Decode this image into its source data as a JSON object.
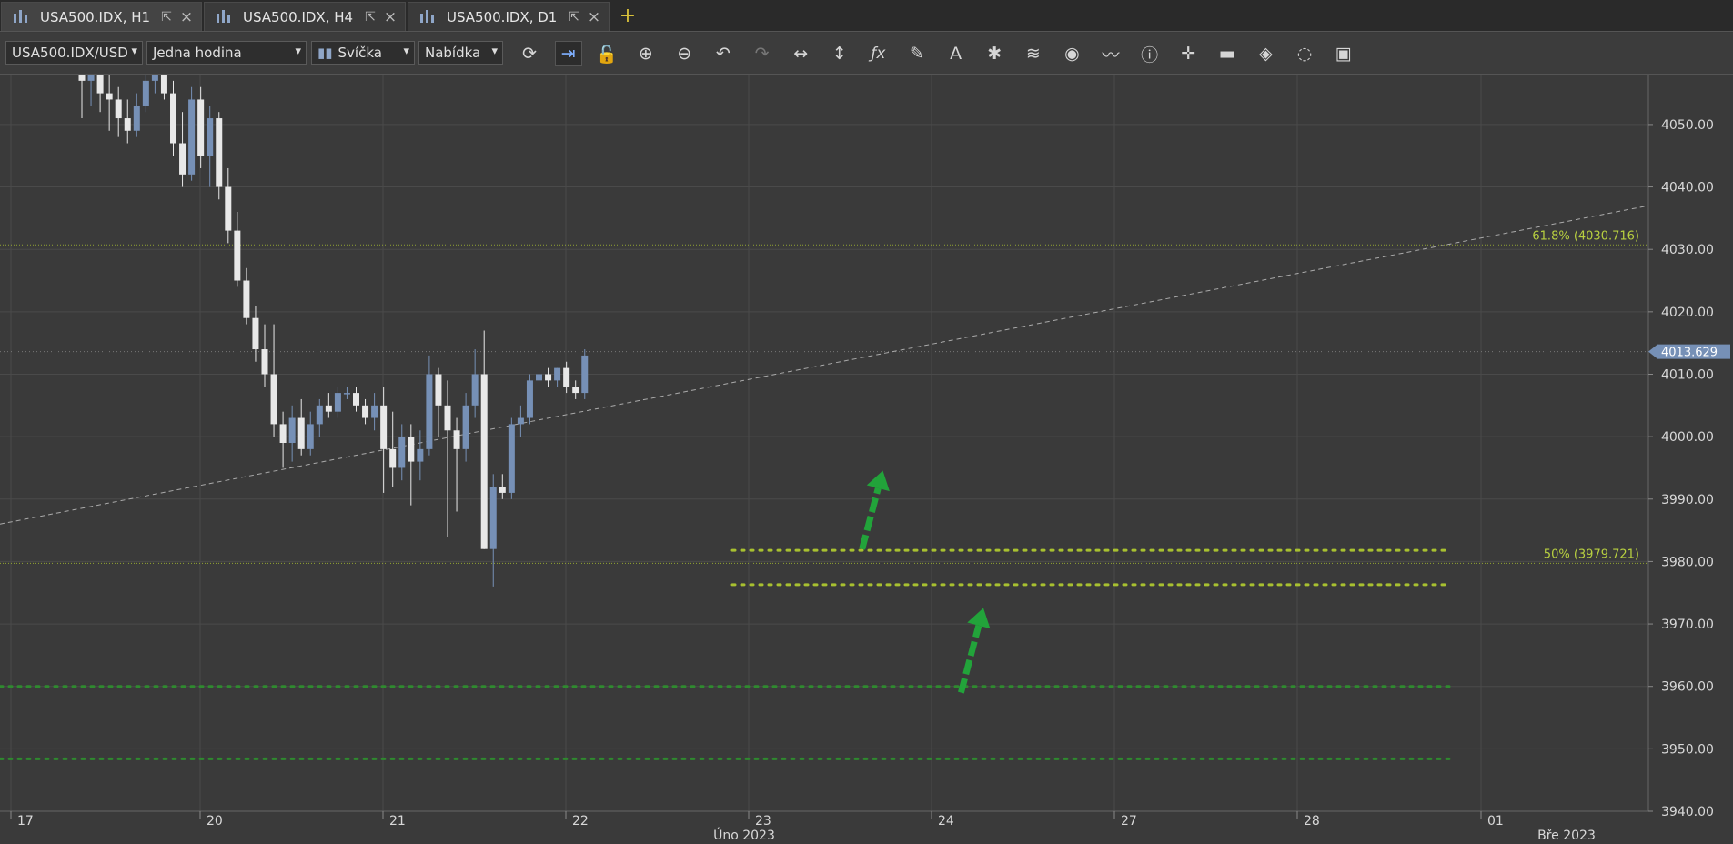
{
  "tabs": [
    {
      "label": "USA500.IDX, H1",
      "active": true
    },
    {
      "label": "USA500.IDX, H4",
      "active": false
    },
    {
      "label": "USA500.IDX, D1",
      "active": false
    }
  ],
  "toolbar": {
    "instrument": "USA500.IDX/USD",
    "period": "Jedna hodina",
    "chart_type": "Svíčka",
    "offer_side": "Nabídka",
    "buttons": [
      "refresh-icon",
      "auto-shift-icon",
      "unlock-icon",
      "zoom-in-icon",
      "zoom-out-icon",
      "undo-icon",
      "redo-icon",
      "horizontal-stretch-icon",
      "vertical-stretch-icon",
      "indicators-icon",
      "pen-icon",
      "text-tool-icon",
      "drawings-icon",
      "layers-icon",
      "eye-icon",
      "indicator-panel-icon",
      "info-icon",
      "crosshair-icon",
      "ohlc-icon",
      "fill-icon",
      "reset-icon",
      "save-icon"
    ]
  },
  "colors": {
    "bg": "#3a3a3a",
    "up": "#7690b6",
    "down": "#e8e8e8",
    "fib": "#a8c030",
    "arrow": "#22a33a",
    "grid": "#4a4a4a"
  },
  "chart_data": {
    "type": "candlestick",
    "ylim": [
      3940,
      4058
    ],
    "y_ticks": [
      "4050.00",
      "4040.00",
      "4030.00",
      "4020.00",
      "4010.00",
      "4000.00",
      "3990.00",
      "3980.00",
      "3970.00",
      "3960.00",
      "3950.00",
      "3940.00"
    ],
    "x_ticks": [
      "17",
      "20",
      "21",
      "22",
      "23",
      "24",
      "27",
      "28",
      "01"
    ],
    "month_labels": [
      "Úno 2023",
      "Bře 2023"
    ],
    "current_price": "4013.629",
    "fib_levels": [
      {
        "label": "61.8% (4030.716)",
        "value": 4030.716
      },
      {
        "label": "50% (3979.721)",
        "value": 3979.721
      }
    ],
    "support_levels": [
      3981.8,
      3976.3,
      3960.0,
      3948.4
    ],
    "trendline": {
      "from": [
        0,
        3986
      ],
      "to": [
        1.0,
        4037
      ]
    },
    "arrows": [
      {
        "from": [
          3982,
          0.523
        ],
        "to": [
          3994,
          0.535
        ]
      },
      {
        "from": [
          3959,
          0.583
        ],
        "to": [
          3972,
          0.596
        ]
      }
    ],
    "candles": [
      {
        "o": 4059,
        "h": 4060,
        "l": 4051,
        "c": 4057
      },
      {
        "o": 4057,
        "h": 4060,
        "l": 4053,
        "c": 4058
      },
      {
        "o": 4058,
        "h": 4060,
        "l": 4052,
        "c": 4055
      },
      {
        "o": 4055,
        "h": 4058,
        "l": 4049,
        "c": 4054
      },
      {
        "o": 4054,
        "h": 4056,
        "l": 4048,
        "c": 4051
      },
      {
        "o": 4051,
        "h": 4054,
        "l": 4047,
        "c": 4049
      },
      {
        "o": 4049,
        "h": 4055,
        "l": 4048,
        "c": 4053
      },
      {
        "o": 4053,
        "h": 4058,
        "l": 4052,
        "c": 4057
      },
      {
        "o": 4057,
        "h": 4059,
        "l": 4055,
        "c": 4058
      },
      {
        "o": 4058,
        "h": 4060,
        "l": 4054,
        "c": 4055
      },
      {
        "o": 4055,
        "h": 4057,
        "l": 4045,
        "c": 4047
      },
      {
        "o": 4047,
        "h": 4052,
        "l": 4040,
        "c": 4042
      },
      {
        "o": 4042,
        "h": 4056,
        "l": 4041,
        "c": 4054
      },
      {
        "o": 4054,
        "h": 4056,
        "l": 4043,
        "c": 4045
      },
      {
        "o": 4045,
        "h": 4053,
        "l": 4040,
        "c": 4051
      },
      {
        "o": 4051,
        "h": 4052,
        "l": 4038,
        "c": 4040
      },
      {
        "o": 4040,
        "h": 4043,
        "l": 4031,
        "c": 4033
      },
      {
        "o": 4033,
        "h": 4036,
        "l": 4024,
        "c": 4025
      },
      {
        "o": 4025,
        "h": 4027,
        "l": 4018,
        "c": 4019
      },
      {
        "o": 4019,
        "h": 4021,
        "l": 4012,
        "c": 4014
      },
      {
        "o": 4014,
        "h": 4018,
        "l": 4008,
        "c": 4010
      },
      {
        "o": 4010,
        "h": 4018,
        "l": 4000,
        "c": 4002
      },
      {
        "o": 4002,
        "h": 4004,
        "l": 3995,
        "c": 3999
      },
      {
        "o": 3999,
        "h": 4005,
        "l": 3996,
        "c": 4003
      },
      {
        "o": 4003,
        "h": 4006,
        "l": 3997,
        "c": 3998
      },
      {
        "o": 3998,
        "h": 4004,
        "l": 3997,
        "c": 4002
      },
      {
        "o": 4002,
        "h": 4006,
        "l": 4000,
        "c": 4005
      },
      {
        "o": 4005,
        "h": 4007,
        "l": 4003,
        "c": 4004
      },
      {
        "o": 4004,
        "h": 4008,
        "l": 4003,
        "c": 4007
      },
      {
        "o": 4007,
        "h": 4008,
        "l": 4006,
        "c": 4007
      },
      {
        "o": 4007,
        "h": 4008,
        "l": 4004,
        "c": 4005
      },
      {
        "o": 4005,
        "h": 4006,
        "l": 4002,
        "c": 4003
      },
      {
        "o": 4003,
        "h": 4007,
        "l": 4001,
        "c": 4005
      },
      {
        "o": 4005,
        "h": 4008,
        "l": 3991,
        "c": 3998
      },
      {
        "o": 3998,
        "h": 4004,
        "l": 3992,
        "c": 3995
      },
      {
        "o": 3995,
        "h": 4002,
        "l": 3993,
        "c": 4000
      },
      {
        "o": 4000,
        "h": 4002,
        "l": 3989,
        "c": 3996
      },
      {
        "o": 3996,
        "h": 4001,
        "l": 3993,
        "c": 3998
      },
      {
        "o": 3998,
        "h": 4013,
        "l": 3997,
        "c": 4010
      },
      {
        "o": 4010,
        "h": 4011,
        "l": 4000,
        "c": 4005
      },
      {
        "o": 4005,
        "h": 4009,
        "l": 3984,
        "c": 4001
      },
      {
        "o": 4001,
        "h": 4003,
        "l": 3988,
        "c": 3998
      },
      {
        "o": 3998,
        "h": 4007,
        "l": 3996,
        "c": 4005
      },
      {
        "o": 4005,
        "h": 4014,
        "l": 4003,
        "c": 4010
      },
      {
        "o": 4010,
        "h": 4017,
        "l": 3982,
        "c": 3982
      },
      {
        "o": 3982,
        "h": 3994,
        "l": 3976,
        "c": 3992
      },
      {
        "o": 3992,
        "h": 3994,
        "l": 3990,
        "c": 3991
      },
      {
        "o": 3991,
        "h": 4003,
        "l": 3990,
        "c": 4002
      },
      {
        "o": 4002,
        "h": 4005,
        "l": 4000,
        "c": 4003
      },
      {
        "o": 4003,
        "h": 4010,
        "l": 4002,
        "c": 4009
      },
      {
        "o": 4009,
        "h": 4012,
        "l": 4007,
        "c": 4010
      },
      {
        "o": 4010,
        "h": 4011,
        "l": 4008,
        "c": 4009
      },
      {
        "o": 4009,
        "h": 4011,
        "l": 4008,
        "c": 4011
      },
      {
        "o": 4011,
        "h": 4012,
        "l": 4007,
        "c": 4008
      },
      {
        "o": 4008,
        "h": 4009,
        "l": 4006,
        "c": 4007
      },
      {
        "o": 4007,
        "h": 4014,
        "l": 4006,
        "c": 4013
      }
    ]
  }
}
